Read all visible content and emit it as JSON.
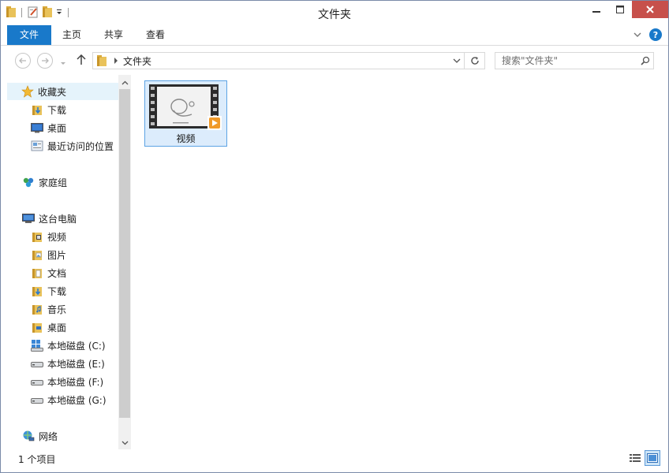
{
  "window": {
    "title": "文件夹"
  },
  "ribbon": {
    "tabs": [
      {
        "label": "文件"
      },
      {
        "label": "主页"
      },
      {
        "label": "共享"
      },
      {
        "label": "查看"
      }
    ],
    "help_label": "?"
  },
  "navbar": {
    "breadcrumb": "文件夹",
    "search_placeholder": "搜索\"文件夹\""
  },
  "sidebar": {
    "favorites": {
      "label": "收藏夹",
      "items": [
        {
          "label": "下载"
        },
        {
          "label": "桌面"
        },
        {
          "label": "最近访问的位置"
        }
      ]
    },
    "homegroup": {
      "label": "家庭组"
    },
    "thispc": {
      "label": "这台电脑",
      "items": [
        {
          "label": "视频"
        },
        {
          "label": "图片"
        },
        {
          "label": "文档"
        },
        {
          "label": "下载"
        },
        {
          "label": "音乐"
        },
        {
          "label": "桌面"
        },
        {
          "label": "本地磁盘 (C:)"
        },
        {
          "label": "本地磁盘 (E:)"
        },
        {
          "label": "本地磁盘 (F:)"
        },
        {
          "label": "本地磁盘 (G:)"
        }
      ]
    },
    "network": {
      "label": "网络"
    }
  },
  "content": {
    "items": [
      {
        "label": "视频"
      }
    ]
  },
  "status": {
    "item_count": "1 个项目"
  },
  "colors": {
    "accent": "#1979ca",
    "selection": "#dcecfc",
    "selection_border": "#5da3e4",
    "close": "#c7504b"
  }
}
